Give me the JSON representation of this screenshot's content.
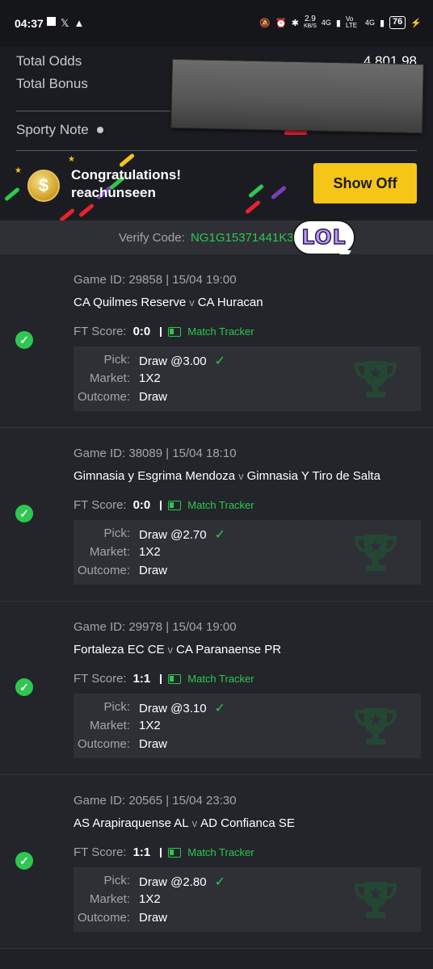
{
  "status_bar": {
    "time": "04:37",
    "net_speed": "2.9",
    "net_unit": "KB/S",
    "signal1": "4G",
    "volte": "Vo LTE",
    "signal2": "4G",
    "battery": "76"
  },
  "summary": {
    "total_odds_label": "Total Odds",
    "total_odds_value": "4,801.98",
    "total_bonus_label": "Total Bonus",
    "sporty_note_label": "Sporty Note"
  },
  "congrats": {
    "line1": "Congratulations!",
    "line2": "reachunseen",
    "coin_symbol": "$",
    "show_off_label": "Show Off"
  },
  "verify": {
    "label": "Verify Code:",
    "code": "NG1G15371441K3",
    "sticker_text": "LOL"
  },
  "games": [
    {
      "game_id_line": "Game ID: 29858 | 15/04 19:00",
      "home": "CA Quilmes Reserve",
      "away": "CA Huracan",
      "ft_label": "FT Score:",
      "ft_score": "0:0",
      "tracker": "Match Tracker",
      "pick_label": "Pick:",
      "pick": "Draw @3.00",
      "market_label": "Market:",
      "market": "1X2",
      "outcome_label": "Outcome:",
      "outcome": "Draw"
    },
    {
      "game_id_line": "Game ID: 38089 | 15/04 18:10",
      "home": "Gimnasia y Esgrima Mendoza",
      "away": "Gimnasia Y Tiro de Salta",
      "ft_label": "FT Score:",
      "ft_score": "0:0",
      "tracker": "Match Tracker",
      "pick_label": "Pick:",
      "pick": "Draw @2.70",
      "market_label": "Market:",
      "market": "1X2",
      "outcome_label": "Outcome:",
      "outcome": "Draw"
    },
    {
      "game_id_line": "Game ID: 29978 | 15/04 19:00",
      "home": "Fortaleza EC CE",
      "away": "CA Paranaense PR",
      "ft_label": "FT Score:",
      "ft_score": "1:1",
      "tracker": "Match Tracker",
      "pick_label": "Pick:",
      "pick": "Draw @3.10",
      "market_label": "Market:",
      "market": "1X2",
      "outcome_label": "Outcome:",
      "outcome": "Draw"
    },
    {
      "game_id_line": "Game ID: 20565 | 15/04 23:30",
      "home": "AS Arapiraquense AL",
      "away": "AD Confianca SE",
      "ft_label": "FT Score:",
      "ft_score": "1:1",
      "tracker": "Match Tracker",
      "pick_label": "Pick:",
      "pick": "Draw @2.80",
      "market_label": "Market:",
      "market": "1X2",
      "outcome_label": "Outcome:",
      "outcome": "Draw"
    }
  ],
  "versus_separator": "v",
  "colors": {
    "accent_green": "#2ec750",
    "button_yellow": "#f5c518",
    "background": "#1f2126"
  }
}
